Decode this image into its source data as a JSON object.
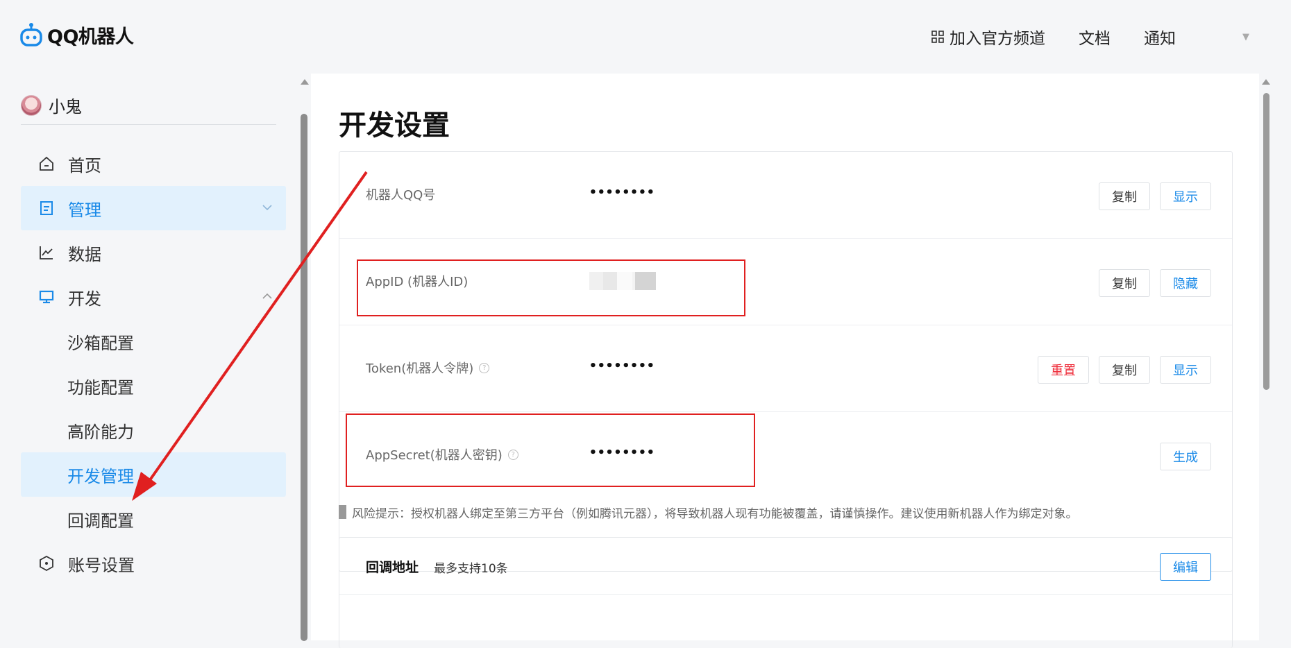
{
  "header": {
    "logo_text": "QQ机器人",
    "nav": [
      {
        "label": "加入官方频道",
        "icon": "grid-icon"
      },
      {
        "label": "文档"
      },
      {
        "label": "通知"
      }
    ]
  },
  "sidebar": {
    "user_name": "小鬼",
    "items": [
      {
        "label": "首页",
        "icon": "home-icon"
      },
      {
        "label": "管理",
        "icon": "manage-icon"
      },
      {
        "label": "数据",
        "icon": "chart-icon"
      },
      {
        "label": "开发",
        "icon": "monitor-icon"
      },
      {
        "label": "沙箱配置"
      },
      {
        "label": "功能配置"
      },
      {
        "label": "高阶能力"
      },
      {
        "label": "开发管理"
      },
      {
        "label": "回调配置"
      },
      {
        "label": "账号设置",
        "icon": "hexagon-icon"
      }
    ]
  },
  "main": {
    "title": "开发设置",
    "credentials": [
      {
        "label": "机器人QQ号",
        "value": "••••••••",
        "buttons": [
          "复制",
          "显示"
        ]
      },
      {
        "label": "AppID (机器人ID)",
        "value": "",
        "buttons": [
          "复制",
          "隐藏"
        ]
      },
      {
        "label": "Token(机器人令牌)",
        "value": "••••••••",
        "buttons": [
          "重置",
          "复制",
          "显示"
        ]
      },
      {
        "label": "AppSecret(机器人密钥)",
        "value": "••••••••",
        "buttons": [
          "生成"
        ]
      }
    ],
    "risk_notice": "风险提示：授权机器人绑定至第三方平台（例如腾讯元器），将导致机器人现有功能被覆盖，请谨慎操作。建议使用新机器人作为绑定对象。",
    "callback": {
      "title": "回调地址",
      "subtitle": "最多支持10条",
      "edit_label": "编辑"
    }
  },
  "colors": {
    "accent": "#1a8ae8",
    "danger": "#ee2d3a",
    "active_bg": "#e2f1fd",
    "annotation": "#e02020"
  }
}
